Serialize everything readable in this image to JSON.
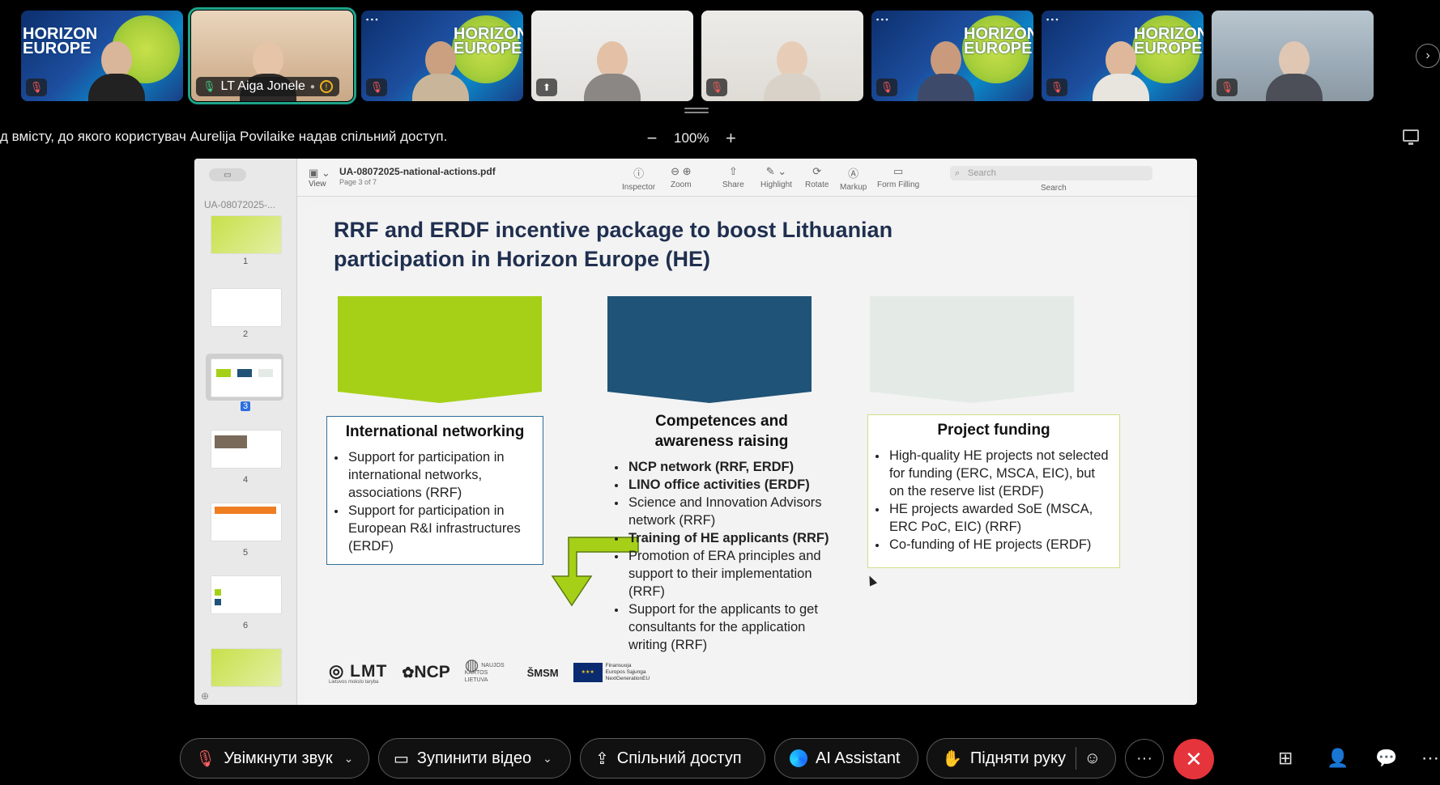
{
  "participants": [
    {
      "name": "",
      "style": "horizon",
      "mic": "muted"
    },
    {
      "name": "LT Aiga Jonele",
      "style": "room1",
      "mic": "on",
      "active": true
    },
    {
      "name": "",
      "style": "horizon",
      "mic": "muted"
    },
    {
      "name": "",
      "style": "room2",
      "mic": "sharing"
    },
    {
      "name": "",
      "style": "room3",
      "mic": "muted"
    },
    {
      "name": "",
      "style": "horizon",
      "mic": "muted"
    },
    {
      "name": "",
      "style": "horizon",
      "mic": "muted"
    },
    {
      "name": "",
      "style": "room4",
      "mic": "muted"
    }
  ],
  "horizon_logo": "HORIZON EUROPE",
  "share_bar": {
    "notice": "д вмісту, до якого користувач Aurelija Povilaike надав спільний доступ.",
    "zoom_out": "−",
    "zoom_level": "100%",
    "zoom_in": "+"
  },
  "pdf": {
    "file_name": "UA-08072025-national-actions.pdf",
    "page_info": "Page 3 of 7",
    "sidebar_title": "UA-08072025-...",
    "thumb_pages": [
      "1",
      "2",
      "3",
      "4",
      "5",
      "6"
    ],
    "toolbar": {
      "view": "View",
      "inspector": "Inspector",
      "zoom": "Zoom",
      "share": "Share",
      "highlight": "Highlight",
      "rotate": "Rotate",
      "markup": "Markup",
      "form_filling": "Form Filling",
      "search_placeholder": "Search",
      "search_label": "Search"
    }
  },
  "slide": {
    "title_line1": "RRF and ERDF incentive package to boost Lithuanian",
    "title_line2": "participation in Horizon Europe (HE)",
    "colors": {
      "green": "#a5d017",
      "blue": "#1f5377",
      "pale": "#e4ebe7"
    },
    "col1": {
      "heading": "International networking",
      "items": [
        "Support for participation in international networks, associations (RRF)",
        "Support for participation in European R&I infrastructures (ERDF)"
      ]
    },
    "col2": {
      "heading": "Competences and awareness raising",
      "items": [
        "NCP network (RRF, ERDF)",
        "LINO office activities (ERDF)",
        "Science and Innovation Advisors network (RRF)",
        "Training of HE applicants (RRF)",
        "Promotion of ERA principles and support to their implementation (RRF)",
        "Support for the applicants to get consultants for the application writing (RRF)"
      ]
    },
    "col3": {
      "heading": "Project funding",
      "items": [
        "High-quality HE projects not selected for funding (ERC, MSCA, EIC), but on the reserve list (ERDF)",
        "HE projects awarded SoE (MSCA, ERC PoC, EIC)  (RRF)",
        "Co-funding of HE projects (ERDF)"
      ]
    },
    "logos": {
      "lmt": "LMT",
      "lmt_sub": "Lietuvos mokslo taryba",
      "ncp": "NCP",
      "nkl_line1": "NAUJOS KARTOS",
      "nkl_line2": "LIETUVA",
      "smsm": "ŠMSM",
      "eu_line1": "Finansuoja",
      "eu_line2": "Europos Sąjunga",
      "eu_line3": "NextGenerationEU"
    }
  },
  "controls": {
    "unmute": "Увімкнути звук",
    "stop_video": "Зупинити відео",
    "share": "Спільний доступ",
    "ai_assistant": "AI Assistant",
    "raise_hand": "Підняти руку"
  }
}
